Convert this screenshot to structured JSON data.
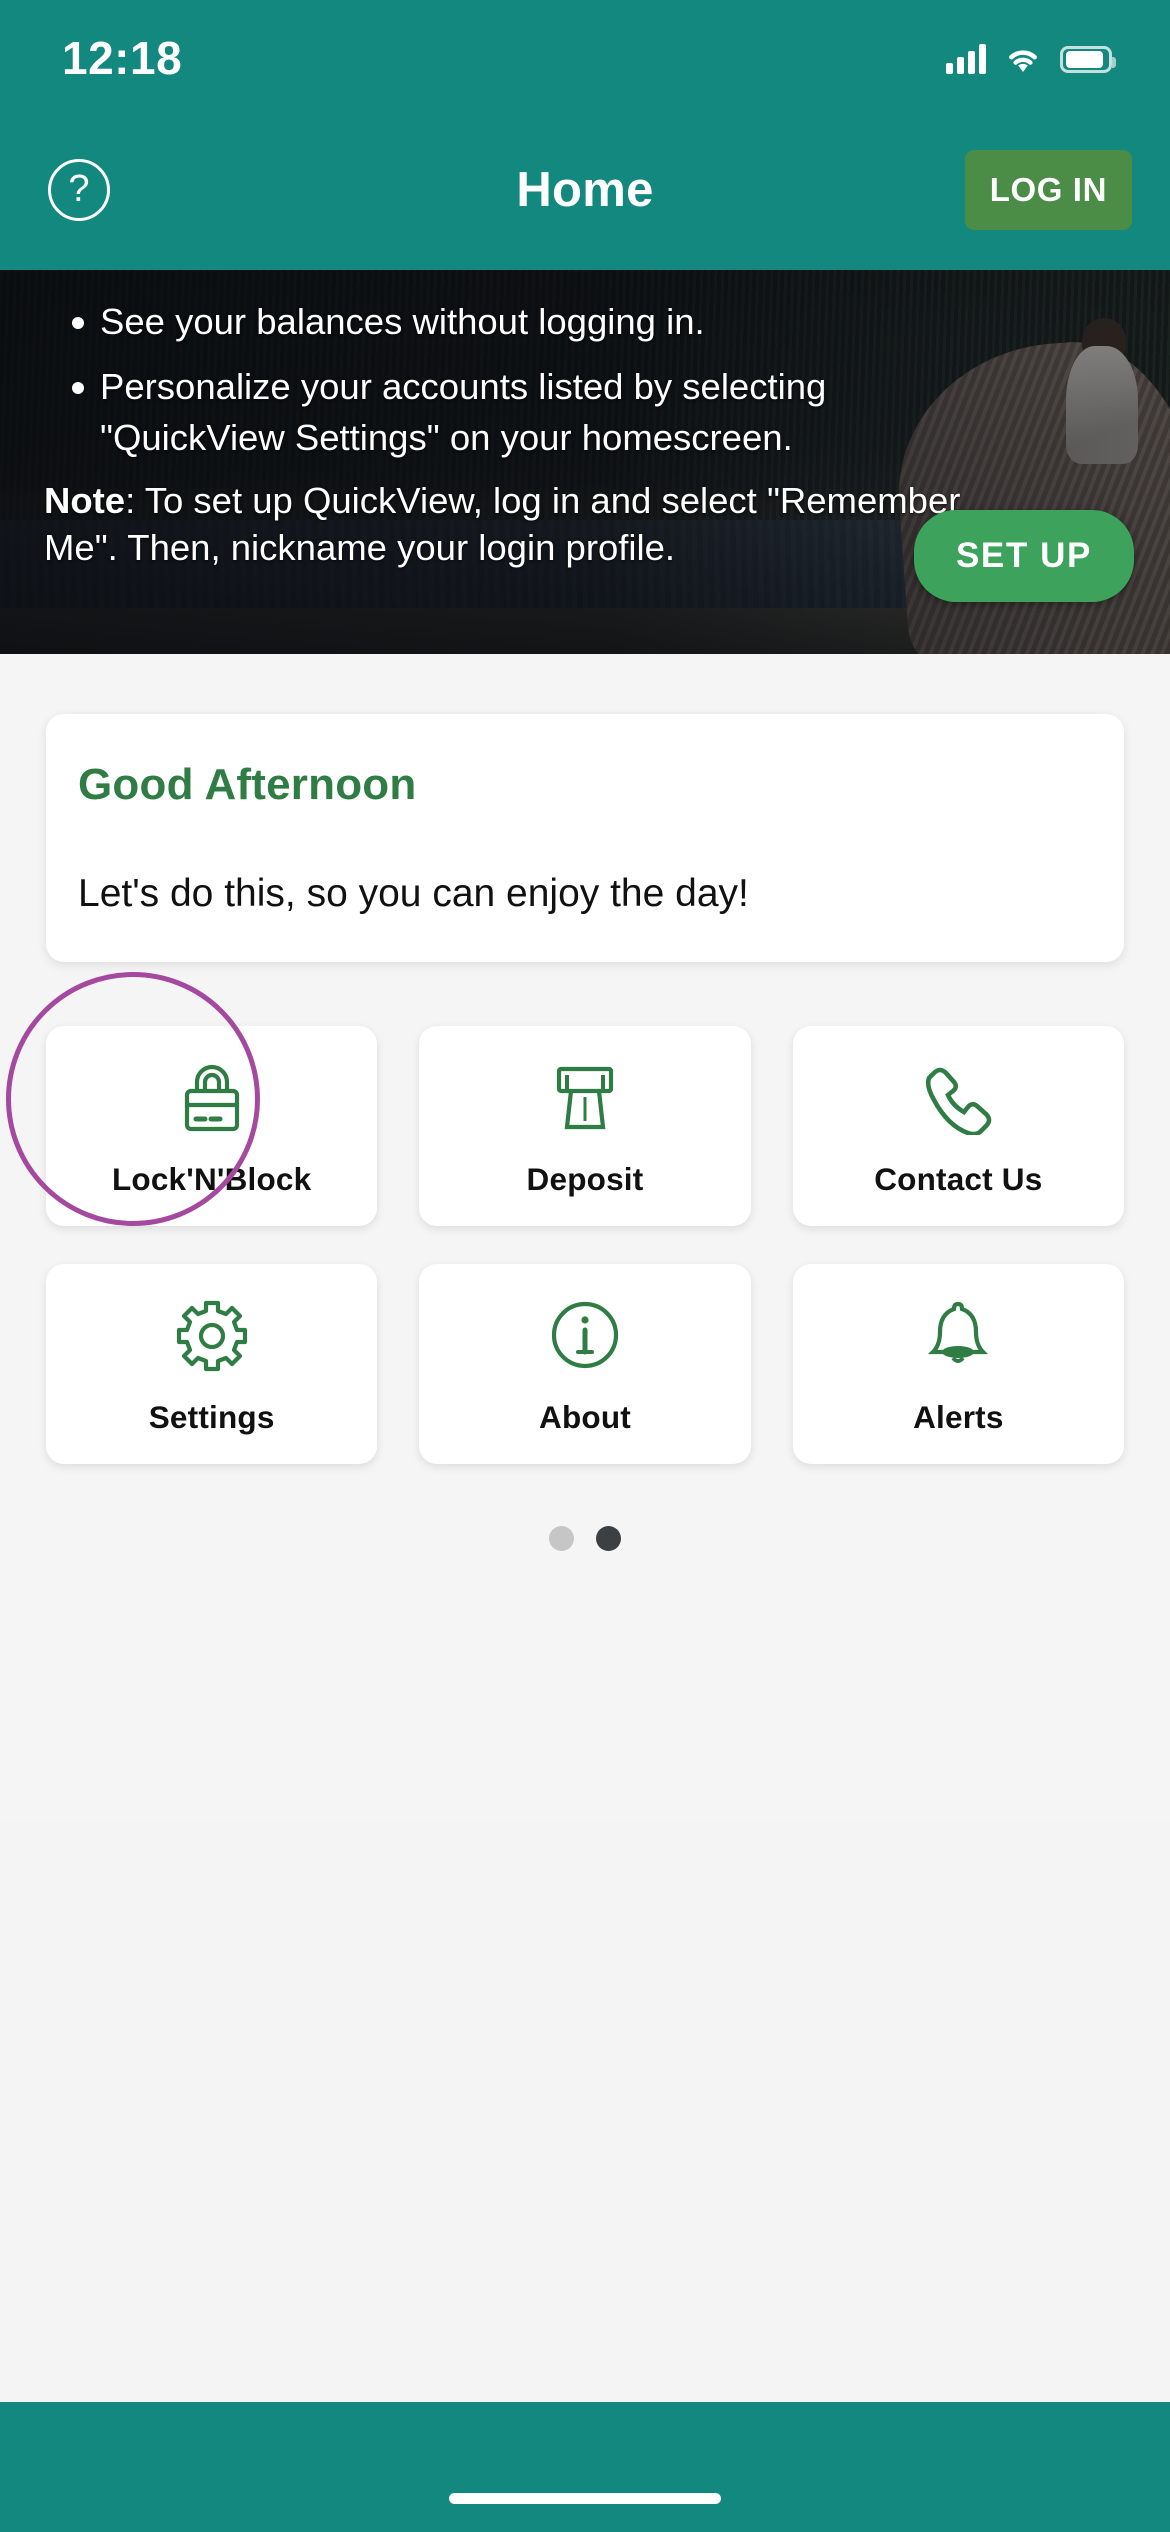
{
  "status_bar": {
    "time": "12:18",
    "signal_icon": "cellular-signal-icon",
    "wifi_icon": "wifi-icon",
    "battery_icon": "battery-icon"
  },
  "nav": {
    "help_label": "?",
    "title": "Home",
    "login_label": "LOG IN"
  },
  "hero": {
    "bullets": [
      "See your balances without logging in.",
      "Personalize your accounts listed by selecting \"QuickView Settings\" on your homescreen."
    ],
    "note_label": "Note",
    "note_body": ": To set up QuickView, log in and select \"Remember Me\". Then, nickname your login profile.",
    "setup_label": "SET UP"
  },
  "greeting": {
    "title": "Good Afternoon",
    "subtitle": "Let's do this, so you can enjoy the day!"
  },
  "tiles": [
    {
      "label": "Lock'N'Block",
      "icon": "card-lock-icon"
    },
    {
      "label": "Deposit",
      "icon": "atm-deposit-icon"
    },
    {
      "label": "Contact Us",
      "icon": "phone-icon"
    },
    {
      "label": "Settings",
      "icon": "gear-icon"
    },
    {
      "label": "About",
      "icon": "info-circle-icon"
    },
    {
      "label": "Alerts",
      "icon": "bell-icon"
    }
  ],
  "pager": {
    "total": 2,
    "active_index": 1
  },
  "annotation": {
    "shape": "circle",
    "target": "Lock'N'Block",
    "color": "#a4499f"
  },
  "colors": {
    "brand_teal": "#12887f",
    "button_green": "#4b8c47",
    "setup_green": "#3da35c",
    "greeting_green": "#2f7d45",
    "icon_green": "#2f7d45",
    "annotation_purple": "#a4499f",
    "page_background": "#f5f5f5"
  }
}
